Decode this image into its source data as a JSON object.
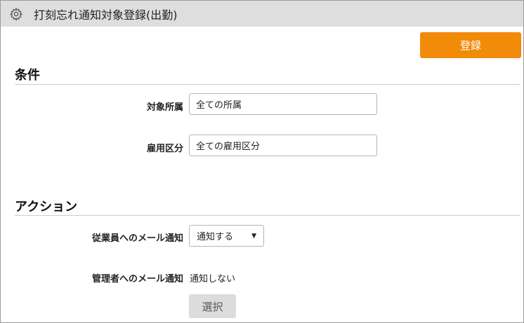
{
  "window": {
    "title": "打刻忘れ通知対象登録(出勤)",
    "icon": "gear-icon"
  },
  "toolbar": {
    "register_label": "登録"
  },
  "conditions": {
    "heading": "条件",
    "department_label": "対象所属",
    "department_value": "全ての所属",
    "employment_label": "雇用区分",
    "employment_value": "全ての雇用区分"
  },
  "actions": {
    "heading": "アクション",
    "employee_mail_label": "従業員へのメール通知",
    "employee_mail_value": "通知する",
    "manager_mail_label": "管理者へのメール通知",
    "manager_mail_value": "通知しない",
    "select_label": "選択"
  },
  "colors": {
    "accent": "#f28a0a",
    "titlebar": "#dedede",
    "button_disabled": "#dcdcdc"
  }
}
